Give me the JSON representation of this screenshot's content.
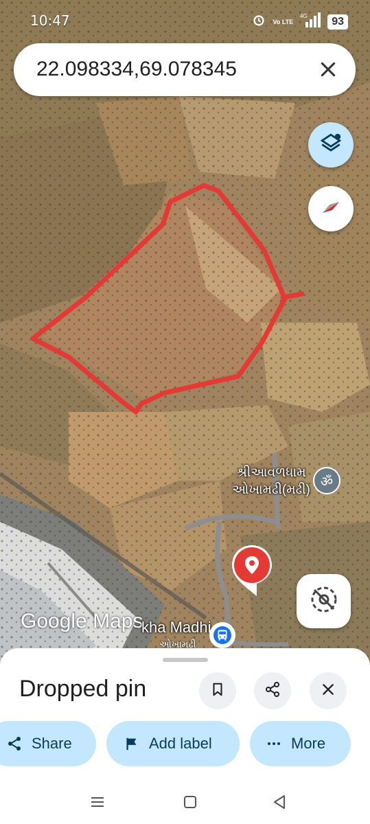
{
  "status_bar": {
    "time": "10:47",
    "volte": "Vo LTE",
    "network": "4G",
    "battery": "93"
  },
  "search": {
    "coordinates": "22.098334,69.078345",
    "close_icon": "close-icon"
  },
  "map": {
    "place_label_line1": "શ્રીઆવળધામ",
    "place_label_line2": "ઓખામઢી(મઢી)",
    "place_icon": "om-icon",
    "station_label": "kha Madhi",
    "station_label_sub": "ઓખામઢી",
    "attribution": "Google Maps",
    "boundary_color": "#e53935",
    "pin_color": "#e53935",
    "layers_icon": "layers-icon",
    "compass_icon": "compass-icon",
    "location_icon": "location-off-icon"
  },
  "sheet": {
    "title": "Dropped pin",
    "save_icon": "bookmark-icon",
    "share_icon": "share-icon",
    "close_icon": "close-icon",
    "chips": {
      "share": "Share",
      "add_label": "Add label",
      "more": "More"
    }
  },
  "nav": {
    "recents_icon": "recents-icon",
    "home_icon": "home-icon",
    "back_icon": "back-icon"
  },
  "colors": {
    "accent_chip": "#c2e7ff",
    "chip_text": "#0b3b5a"
  }
}
